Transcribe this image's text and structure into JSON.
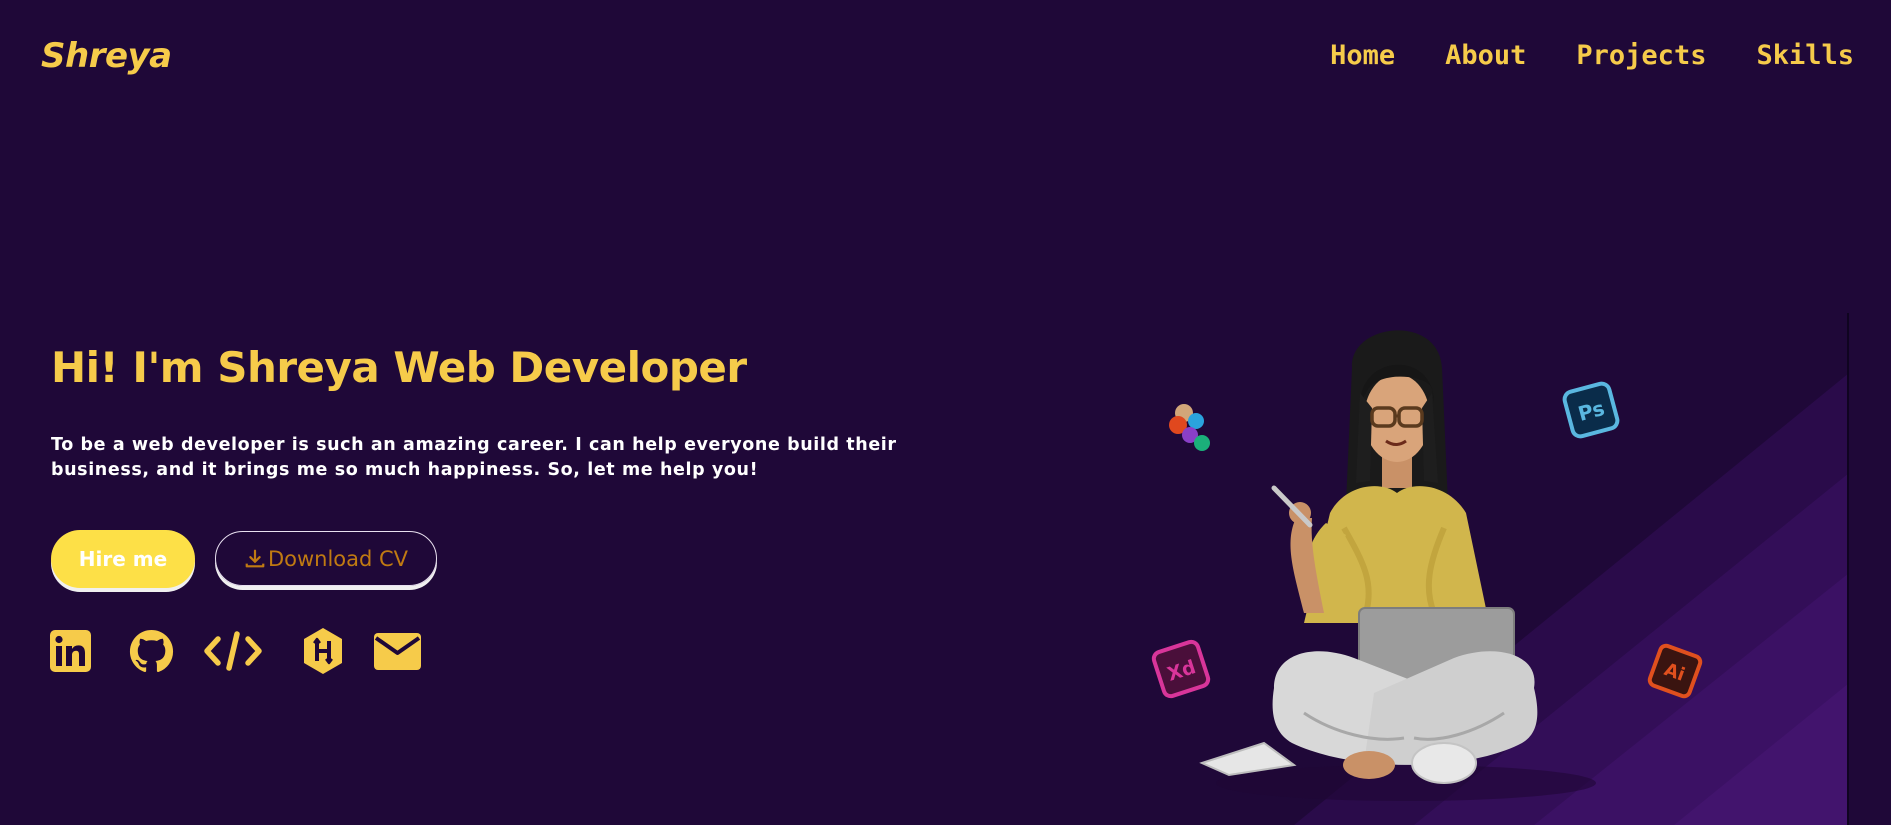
{
  "header": {
    "logo": "Shreya",
    "nav": [
      {
        "label": "Home"
      },
      {
        "label": "About"
      },
      {
        "label": "Projects"
      },
      {
        "label": "Skills"
      }
    ]
  },
  "hero": {
    "title": "Hi! I'm Shreya Web Developer",
    "description": "To be a web developer is such an amazing career. I can help everyone build their business, and it brings me so much happiness. So, let me help you!",
    "hire_button": "Hire me",
    "cv_button": "Download CV"
  },
  "socials": [
    {
      "icon": "linkedin-icon"
    },
    {
      "icon": "github-icon"
    },
    {
      "icon": "code-icon"
    },
    {
      "icon": "hackerrank-icon"
    },
    {
      "icon": "email-icon"
    }
  ],
  "illustration": {
    "badges": [
      "Ps",
      "Xd",
      "Ai"
    ]
  },
  "colors": {
    "background": "#1f0838",
    "accent": "#f6cb4a",
    "button": "#fde047",
    "cv_text": "#c07a12"
  }
}
